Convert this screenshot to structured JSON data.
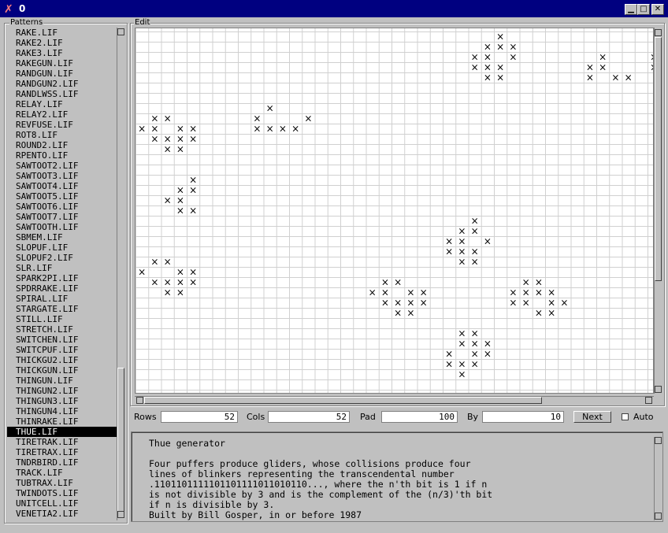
{
  "window": {
    "title": "0",
    "buttons": [
      "minimize",
      "maximize",
      "close"
    ]
  },
  "patterns_panel": {
    "label": "Patterns",
    "items": [
      "RAKE.LIF",
      "RAKE2.LIF",
      "RAKE3.LIF",
      "RAKEGUN.LIF",
      "RANDGUN.LIF",
      "RANDGUN2.LIF",
      "RANDLWSS.LIF",
      "RELAY.LIF",
      "RELAY2.LIF",
      "REVFUSE.LIF",
      "ROT8.LIF",
      "ROUND2.LIF",
      "RPENTO.LIF",
      "SAWTOOT2.LIF",
      "SAWTOOT3.LIF",
      "SAWTOOT4.LIF",
      "SAWTOOT5.LIF",
      "SAWTOOT6.LIF",
      "SAWTOOT7.LIF",
      "SAWTOOTH.LIF",
      "SBMEM.LIF",
      "SLOPUF.LIF",
      "SLOPUF2.LIF",
      "SLR.LIF",
      "SPARK2PI.LIF",
      "SPDRRAKE.LIF",
      "SPIRAL.LIF",
      "STARGATE.LIF",
      "STILL.LIF",
      "STRETCH.LIF",
      "SWITCHEN.LIF",
      "SWITCPUF.LIF",
      "THICKGU2.LIF",
      "THICKGUN.LIF",
      "THINGUN.LIF",
      "THINGUN2.LIF",
      "THINGUN3.LIF",
      "THINGUN4.LIF",
      "THINRAKE.LIF",
      "THUE.LIF",
      "TIRETRAK.LIF",
      "TIRETRAX.LIF",
      "TNDRBIRD.LIF",
      "TRACK.LIF",
      "TUBTRAX.LIF",
      "TWINDOTS.LIF",
      "UNITCELL.LIF",
      "VENETIA2.LIF"
    ],
    "selected": "THUE.LIF"
  },
  "edit_panel": {
    "label": "Edit",
    "cell_marker": "×",
    "cells": [
      [
        28,
        0
      ],
      [
        27,
        1
      ],
      [
        28,
        1
      ],
      [
        29,
        1
      ],
      [
        26,
        2
      ],
      [
        27,
        2
      ],
      [
        29,
        2
      ],
      [
        26,
        3
      ],
      [
        27,
        3
      ],
      [
        28,
        3
      ],
      [
        27,
        4
      ],
      [
        28,
        4
      ],
      [
        36,
        2
      ],
      [
        35,
        3
      ],
      [
        36,
        3
      ],
      [
        35,
        4
      ],
      [
        37,
        4
      ],
      [
        38,
        4
      ],
      [
        40,
        2
      ],
      [
        40,
        3
      ],
      [
        10,
        7
      ],
      [
        9,
        8
      ],
      [
        13,
        8
      ],
      [
        9,
        9
      ],
      [
        10,
        9
      ],
      [
        11,
        9
      ],
      [
        12,
        9
      ],
      [
        1,
        8
      ],
      [
        2,
        8
      ],
      [
        0,
        9
      ],
      [
        1,
        9
      ],
      [
        3,
        9
      ],
      [
        4,
        9
      ],
      [
        1,
        10
      ],
      [
        2,
        10
      ],
      [
        3,
        10
      ],
      [
        4,
        10
      ],
      [
        2,
        11
      ],
      [
        3,
        11
      ],
      [
        4,
        14
      ],
      [
        3,
        15
      ],
      [
        4,
        15
      ],
      [
        2,
        16
      ],
      [
        3,
        16
      ],
      [
        3,
        17
      ],
      [
        4,
        17
      ],
      [
        26,
        18
      ],
      [
        25,
        19
      ],
      [
        26,
        19
      ],
      [
        24,
        20
      ],
      [
        25,
        20
      ],
      [
        27,
        20
      ],
      [
        24,
        21
      ],
      [
        25,
        21
      ],
      [
        26,
        21
      ],
      [
        25,
        22
      ],
      [
        26,
        22
      ],
      [
        1,
        22
      ],
      [
        2,
        22
      ],
      [
        0,
        23
      ],
      [
        3,
        23
      ],
      [
        4,
        23
      ],
      [
        1,
        24
      ],
      [
        2,
        24
      ],
      [
        3,
        24
      ],
      [
        4,
        24
      ],
      [
        2,
        25
      ],
      [
        3,
        25
      ],
      [
        19,
        24
      ],
      [
        20,
        24
      ],
      [
        18,
        25
      ],
      [
        19,
        25
      ],
      [
        21,
        25
      ],
      [
        22,
        25
      ],
      [
        19,
        26
      ],
      [
        20,
        26
      ],
      [
        21,
        26
      ],
      [
        22,
        26
      ],
      [
        20,
        27
      ],
      [
        21,
        27
      ],
      [
        30,
        24
      ],
      [
        31,
        24
      ],
      [
        29,
        25
      ],
      [
        30,
        25
      ],
      [
        31,
        25
      ],
      [
        32,
        25
      ],
      [
        29,
        26
      ],
      [
        30,
        26
      ],
      [
        32,
        26
      ],
      [
        33,
        26
      ],
      [
        31,
        27
      ],
      [
        32,
        27
      ],
      [
        25,
        29
      ],
      [
        26,
        29
      ],
      [
        25,
        30
      ],
      [
        26,
        30
      ],
      [
        27,
        30
      ],
      [
        24,
        31
      ],
      [
        26,
        31
      ],
      [
        27,
        31
      ],
      [
        24,
        32
      ],
      [
        25,
        32
      ],
      [
        26,
        32
      ],
      [
        25,
        33
      ]
    ]
  },
  "controls": {
    "rows_label": "Rows",
    "rows_value": "52",
    "cols_label": "Cols",
    "cols_value": "52",
    "pad_label": "Pad",
    "pad_value": "100",
    "by_label": "By",
    "by_value": "10",
    "next_label": "Next",
    "auto_label": "Auto",
    "auto_checked": false
  },
  "description": {
    "text": "Thue generator\n\nFour puffers produce gliders, whose collisions produce four\nlines of blinkers representing the transcendental number\n.1101101111101101111011010110..., where the n'th bit is 1 if n\nis not divisible by 3 and is the complement of the (n/3)'th bit\nif n is divisible by 3.\nBuilt by Bill Gosper, in or before 1987"
  }
}
